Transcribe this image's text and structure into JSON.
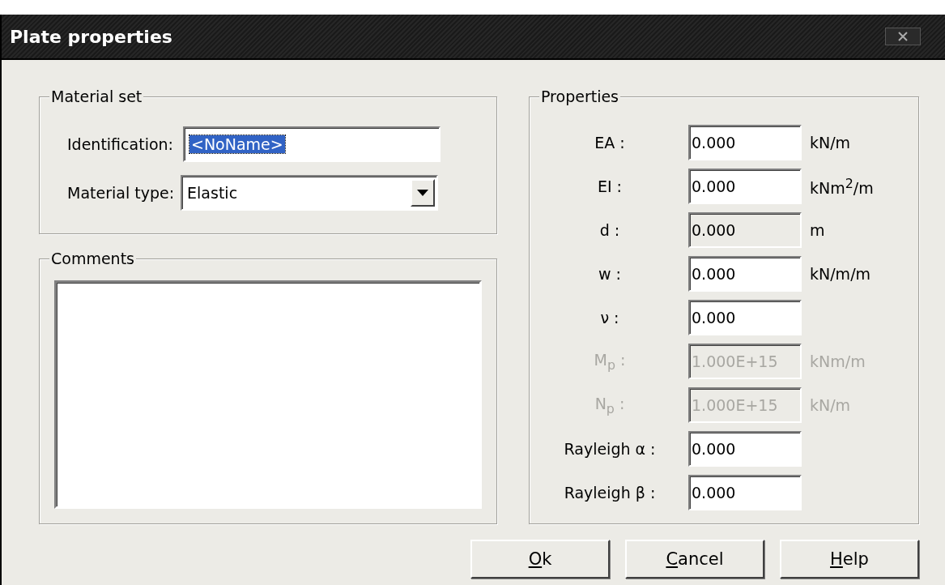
{
  "window": {
    "title": "Plate properties"
  },
  "material_set": {
    "title": "Material set",
    "fields": [
      {
        "kind": "text",
        "label": "Identification:",
        "value": "<NoName>",
        "selected": true
      },
      {
        "kind": "dropdown",
        "label": "Material type:",
        "value": "Elastic",
        "selected": false
      }
    ]
  },
  "comments": {
    "title": "Comments"
  },
  "properties": {
    "title": "Properties",
    "rows": [
      {
        "label": "EA :",
        "value": "0.000",
        "unit": "kN/m",
        "kind": "normal"
      },
      {
        "label": "EI :",
        "value": "0.000",
        "unit": "kNm$^{2}$/m",
        "kind": "normal"
      },
      {
        "label": "d :",
        "value": "0.000",
        "unit": "m",
        "kind": "readonly"
      },
      {
        "label": "w :",
        "value": "0.000",
        "unit": "kN/m/m",
        "kind": "normal"
      },
      {
        "label": "ν :",
        "value": "0.000",
        "kind": "normal"
      },
      {
        "label": "M$_{p}$ :",
        "value": "1.000E+15",
        "unit": "kNm/m",
        "kind": "disabled"
      },
      {
        "label": "N$_{p}$ :",
        "value": "1.000E+15",
        "unit": "kN/m",
        "kind": "disabled"
      },
      {
        "label": "Rayleigh α :",
        "value": "0.000",
        "kind": "normal"
      },
      {
        "label": "Rayleigh β :",
        "value": "0.000",
        "kind": "normal"
      }
    ]
  },
  "buttons": [
    {
      "label": "Ok",
      "mnemonic": true
    },
    {
      "label": "Cancel",
      "mnemonic": true
    },
    {
      "label": "Help",
      "mnemonic": true
    }
  ]
}
